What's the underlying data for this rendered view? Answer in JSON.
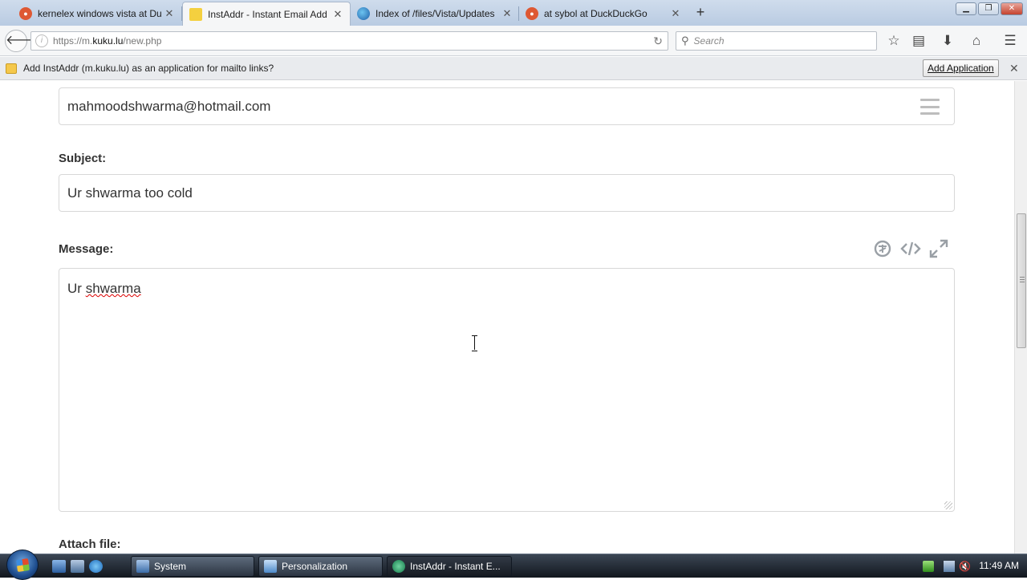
{
  "browser": {
    "tabs": [
      {
        "title": "kernelex windows vista at Du",
        "icon": "duckduckgo-icon",
        "active": false
      },
      {
        "title": "InstAddr - Instant Email Add",
        "icon": "instaddr-icon",
        "active": true
      },
      {
        "title": "Index of /files/Vista/Updates",
        "icon": "globe-icon",
        "active": false
      },
      {
        "title": "at sybol at DuckDuckGo",
        "icon": "duckduckgo-icon",
        "active": false
      }
    ],
    "url_prefix": "https://m.",
    "url_domain": "kuku.lu",
    "url_path": "/new.php",
    "search_placeholder": "Search",
    "notification": {
      "message": "Add InstAddr (m.kuku.lu) as an application for mailto links?",
      "button_label": "Add Application"
    }
  },
  "compose": {
    "to_value": "mahmoodshwarma@hotmail.com",
    "subject_label": "Subject:",
    "subject_value": "Ur shwarma too cold",
    "message_label": "Message:",
    "message_word1": "Ur",
    "message_word2": "shwarma",
    "attach_label": "Attach file:"
  },
  "taskbar": {
    "buttons": [
      {
        "label": "System",
        "active": false
      },
      {
        "label": "Personalization",
        "active": false
      },
      {
        "label": "InstAddr - Instant E...",
        "active": true
      }
    ],
    "clock": "11:49 AM"
  },
  "colors": {
    "tab_strip": "#c4d4e8",
    "active_tab": "#f5f6f7",
    "field_border": "#d8d8d8",
    "label_text": "#333333",
    "taskbar": "#1e2530",
    "spellcheck": "#dd0000"
  }
}
